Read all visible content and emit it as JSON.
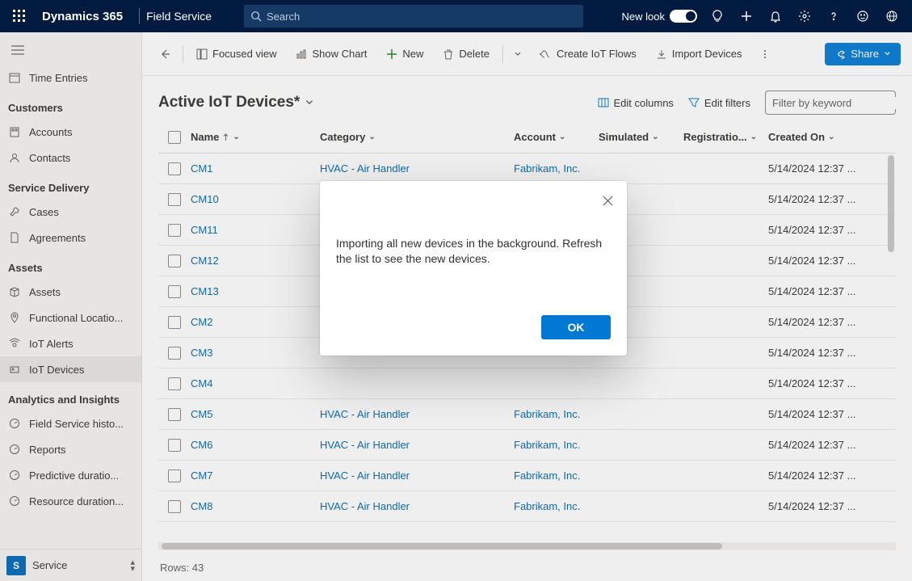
{
  "top": {
    "brand": "Dynamics 365",
    "product": "Field Service",
    "search_placeholder": "Search",
    "newlook": "New look"
  },
  "sidebar": {
    "time_entries": "Time Entries",
    "heading_customers": "Customers",
    "accounts": "Accounts",
    "contacts": "Contacts",
    "heading_service": "Service Delivery",
    "cases": "Cases",
    "agreements": "Agreements",
    "heading_assets": "Assets",
    "assets": "Assets",
    "functional": "Functional Locatio...",
    "iot_alerts": "IoT Alerts",
    "iot_devices": "IoT Devices",
    "heading_analytics": "Analytics and Insights",
    "fs_history": "Field Service histo...",
    "reports": "Reports",
    "predictive": "Predictive duratio...",
    "resource": "Resource duration...",
    "area_badge": "S",
    "area_label": "Service"
  },
  "cmd": {
    "focused": "Focused view",
    "chart": "Show Chart",
    "new": "New",
    "delete": "Delete",
    "flows": "Create IoT Flows",
    "import": "Import Devices",
    "share": "Share"
  },
  "sub": {
    "title": "Active IoT Devices*",
    "edit_columns": "Edit columns",
    "edit_filters": "Edit filters",
    "filter_placeholder": "Filter by keyword"
  },
  "cols": {
    "name": "Name",
    "category": "Category",
    "account": "Account",
    "simulated": "Simulated",
    "registration": "Registratio...",
    "created": "Created On"
  },
  "rows": [
    {
      "name": "CM1",
      "category": "HVAC - Air Handler",
      "account": "Fabrikam, Inc.",
      "created": "5/14/2024 12:37 ..."
    },
    {
      "name": "CM10",
      "category": "",
      "account": "",
      "created": "5/14/2024 12:37 ..."
    },
    {
      "name": "CM11",
      "category": "",
      "account": "",
      "created": "5/14/2024 12:37 ..."
    },
    {
      "name": "CM12",
      "category": "",
      "account": "",
      "created": "5/14/2024 12:37 ..."
    },
    {
      "name": "CM13",
      "category": "",
      "account": "",
      "created": "5/14/2024 12:37 ..."
    },
    {
      "name": "CM2",
      "category": "",
      "account": "",
      "created": "5/14/2024 12:37 ..."
    },
    {
      "name": "CM3",
      "category": "",
      "account": "",
      "created": "5/14/2024 12:37 ..."
    },
    {
      "name": "CM4",
      "category": "",
      "account": "",
      "created": "5/14/2024 12:37 ..."
    },
    {
      "name": "CM5",
      "category": "HVAC - Air Handler",
      "account": "Fabrikam, Inc.",
      "created": "5/14/2024 12:37 ..."
    },
    {
      "name": "CM6",
      "category": "HVAC - Air Handler",
      "account": "Fabrikam, Inc.",
      "created": "5/14/2024 12:37 ..."
    },
    {
      "name": "CM7",
      "category": "HVAC - Air Handler",
      "account": "Fabrikam, Inc.",
      "created": "5/14/2024 12:37 ..."
    },
    {
      "name": "CM8",
      "category": "HVAC - Air Handler",
      "account": "Fabrikam, Inc.",
      "created": "5/14/2024 12:37 ..."
    }
  ],
  "footer": {
    "rows_label": "Rows: 43"
  },
  "modal": {
    "message": "Importing all new devices in the background. Refresh the list to see the new devices.",
    "ok": "OK"
  }
}
